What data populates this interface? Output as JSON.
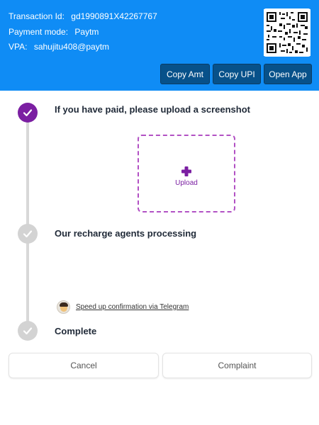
{
  "header": {
    "transaction_label": "Transaction Id:",
    "transaction_id": "gd1990891X42267767",
    "payment_mode_label": "Payment mode:",
    "payment_mode": "Paytm",
    "vpa_label": "VPA:",
    "vpa": "sahujitu408@paytm",
    "buttons": {
      "copy_amt": "Copy Amt",
      "copy_upi": "Copy UPI",
      "open_app": "Open App"
    },
    "bg_color": "#0f8cf5",
    "button_color": "#07518a"
  },
  "steps": [
    {
      "title": "If you have paid, please upload a screenshot",
      "status": "done"
    },
    {
      "title": "Our recharge agents processing",
      "status": "pending"
    },
    {
      "title": "Complete",
      "status": "pending"
    }
  ],
  "upload": {
    "label": "Upload",
    "accent": "#7b1fa2"
  },
  "telegram": {
    "link_text": "Speed up confirmation via Telegram"
  },
  "footer": {
    "cancel": "Cancel",
    "complaint": "Complaint"
  },
  "icons": {
    "qr": "qr-code-icon",
    "check": "check-icon",
    "plus": "plus-icon",
    "avatar": "avatar-icon"
  }
}
